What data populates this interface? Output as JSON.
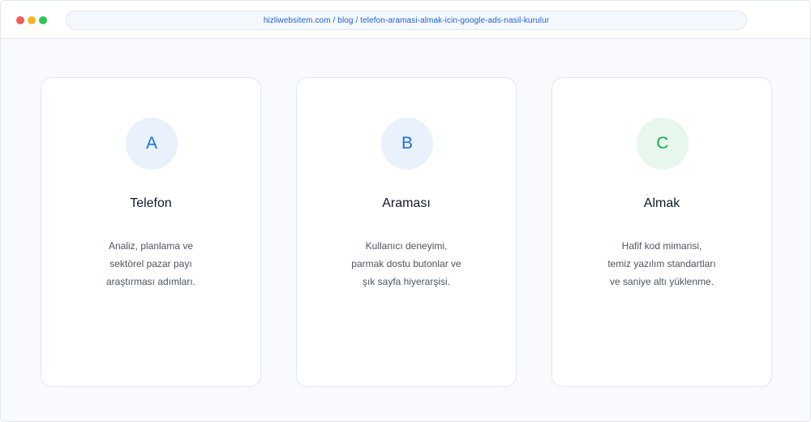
{
  "window": {
    "controls": [
      {
        "name": "close",
        "color": "#f05a57"
      },
      {
        "name": "minimize",
        "color": "#f2b62b"
      },
      {
        "name": "maximize",
        "color": "#2dc653"
      }
    ]
  },
  "address_bar": {
    "url": "hizliwebsitem.com / blog / telefon-aramasi-almak-icin-google-ads-nasil-kurulur",
    "text_color": "#1e5fd6"
  },
  "cards": [
    {
      "letter": "A",
      "title": "Telefon",
      "description": [
        "Analiz, planlama ve",
        "sektörel pazar payı",
        "araştırması adımları."
      ],
      "badge_bg": "#e8f1fc",
      "badge_color": "#1a6fe0"
    },
    {
      "letter": "B",
      "title": "Araması",
      "description": [
        "Kullanıcı deneyimi,",
        "parmak dostu butonlar ve",
        "şık sayfa hiyerarşisi."
      ],
      "badge_bg": "#e8f1fc",
      "badge_color": "#1a6fe0"
    },
    {
      "letter": "C",
      "title": "Almak",
      "description": [
        "Hafif kod mimarisi,",
        "temiz yazılım standartları",
        "ve saniye altı yüklenme."
      ],
      "badge_bg": "#e7f7ed",
      "badge_color": "#18a957"
    }
  ]
}
